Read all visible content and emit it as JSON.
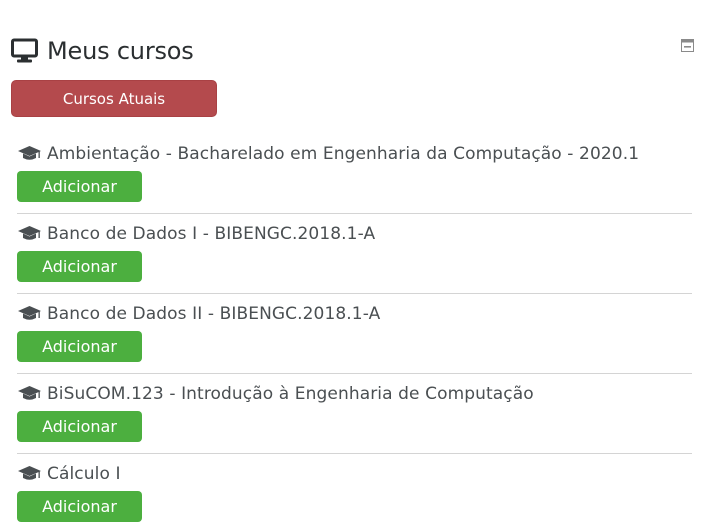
{
  "block": {
    "title": "Meus cursos",
    "icon": "monitor-icon",
    "collapse_icon": "collapse-icon"
  },
  "tabs": [
    {
      "label": "Cursos Atuais",
      "active": true
    }
  ],
  "courses": [
    {
      "name": "Ambientação - Bacharelado em Engenharia da Computação - 2020.1",
      "action_label": "Adicionar",
      "icon": "graduation-cap-icon"
    },
    {
      "name": "Banco de Dados I - BIBENGC.2018.1-A",
      "action_label": "Adicionar",
      "icon": "graduation-cap-icon"
    },
    {
      "name": "Banco de Dados II - BIBENGC.2018.1-A",
      "action_label": "Adicionar",
      "icon": "graduation-cap-icon"
    },
    {
      "name": "BiSuCOM.123 - Introdução à Engenharia de Computação",
      "action_label": "Adicionar",
      "icon": "graduation-cap-icon"
    },
    {
      "name": "Cálculo I",
      "action_label": "Adicionar",
      "icon": "graduation-cap-icon"
    }
  ],
  "colors": {
    "tab_active": "#b44a4d",
    "add_button": "#4caf3f",
    "divider": "#d4d4d4",
    "text": "#4a4f52"
  }
}
